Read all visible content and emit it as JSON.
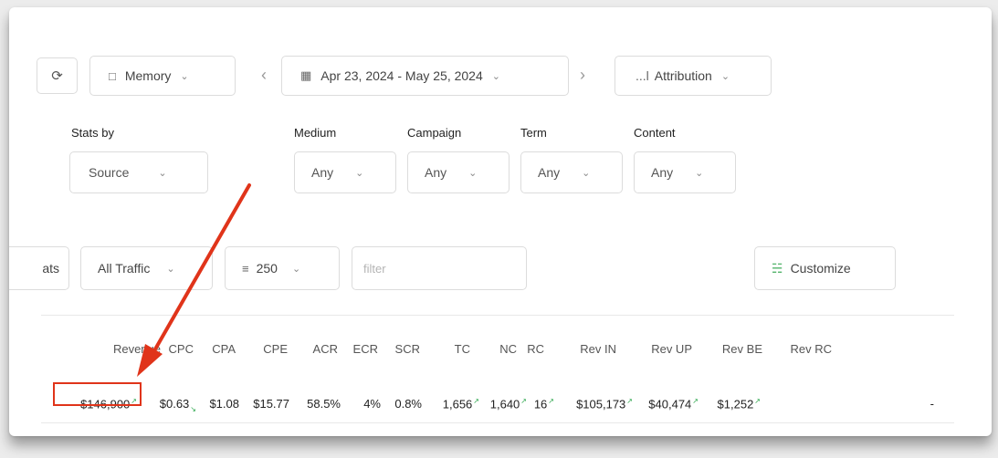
{
  "toolbar": {
    "refresh_icon": "refresh-icon",
    "memory_label": "Memory",
    "date_range": "Apr 23, 2024 - May 25, 2024",
    "attribution_label": "Attribution",
    "attribution_prefix": "...l"
  },
  "filters": {
    "stats_by": {
      "label": "Stats by",
      "value": "Source"
    },
    "medium": {
      "label": "Medium",
      "value": "Any"
    },
    "campaign": {
      "label": "Campaign",
      "value": "Any"
    },
    "term": {
      "label": "Term",
      "value": "Any"
    },
    "content": {
      "label": "Content",
      "value": "Any"
    }
  },
  "controls": {
    "stats_tab_partial": "ats",
    "traffic_value": "All Traffic",
    "rows_value": "250",
    "filter_placeholder": "filter",
    "customize_label": "Customize"
  },
  "table": {
    "headers": [
      "Revenue",
      "CPC",
      "CPA",
      "CPE",
      "ACR",
      "ECR",
      "SCR",
      "TC",
      "NC",
      "RC",
      "Rev IN",
      "Rev UP",
      "Rev BE",
      "Rev RC"
    ],
    "row": [
      "$146,900",
      "$0.63",
      "$1.08",
      "$15.77",
      "58.5%",
      "4%",
      "0.8%",
      "1,656",
      "1,640",
      "16",
      "$105,173",
      "$40,474",
      "$1,252",
      "-"
    ]
  },
  "colors": {
    "annotation": "#e0341a",
    "trend_up": "#2fa84f",
    "customize_icon": "#52b36a"
  }
}
